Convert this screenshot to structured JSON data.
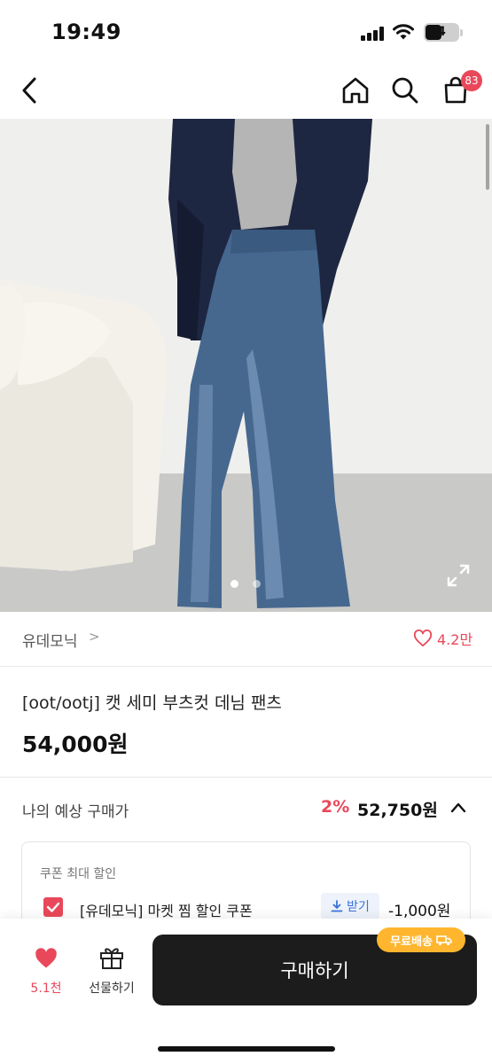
{
  "status_bar": {
    "time": "19:49",
    "battery": "4"
  },
  "nav": {
    "cart_badge": "83"
  },
  "product": {
    "brand": "유데모닉",
    "brand_chevron": ">",
    "likes": "4.2만",
    "title": "[oot/ootj] 캣 세미 부츠컷 데님 팬츠",
    "price": "54,000원",
    "image_page_count": 2,
    "image_current_page": 1
  },
  "estimate": {
    "label": "나의 예상 구매가",
    "discount": "2%",
    "price": "52,750원"
  },
  "coupon": {
    "header": "쿠폰 최대 할인",
    "name": "[유데모닉] 마켓 찜 할인 쿠폰",
    "get_label": "받기",
    "amount": "-1,000원"
  },
  "bottom": {
    "wish_count": "5.1천",
    "gift_label": "선물하기",
    "buy_label": "구매하기",
    "free_shipping": "무료배송"
  },
  "colors": {
    "accent": "#e9485a",
    "buy_button": "#1c1c1c",
    "shipping_badge": "#ffb62e",
    "coupon_link": "#3a72d6"
  }
}
